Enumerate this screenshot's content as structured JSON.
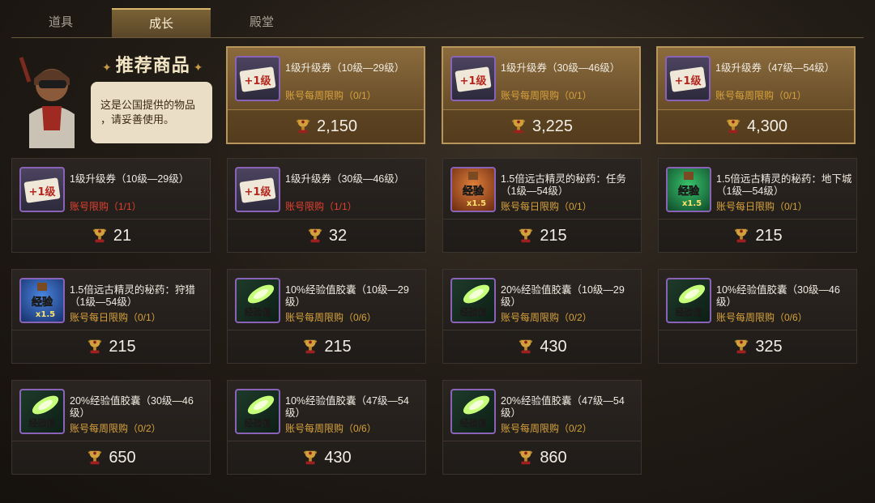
{
  "tabs": [
    {
      "label": "道具"
    },
    {
      "label": "成长"
    },
    {
      "label": "殿堂"
    }
  ],
  "promo": {
    "title": "推荐商品",
    "text_line1": "这是公国提供的物品",
    "text_line2": "，请妥善使用。"
  },
  "items": [
    {
      "name": "1级升级券（10级—29级）",
      "limit": "账号每周限购（0/1）",
      "price": "2,150",
      "icon": "level-ticket-icon"
    },
    {
      "name": "1级升级券（30级—46级）",
      "limit": "账号每周限购（0/1）",
      "price": "3,225",
      "icon": "level-ticket-icon"
    },
    {
      "name": "1级升级券（47级—54级）",
      "limit": "账号每周限购（0/1）",
      "price": "4,300",
      "icon": "level-ticket-icon"
    },
    {
      "name": "1级升级券（10级—29级）",
      "limit": "账号限购（1/1）",
      "price": "21",
      "icon": "level-ticket-icon"
    },
    {
      "name": "1级升级券（30级—46级）",
      "limit": "账号限购（1/1）",
      "price": "32",
      "icon": "level-ticket-icon"
    },
    {
      "name": "1.5倍远古精灵的秘药：任务（1级—54级）",
      "limit": "账号每日限购（0/1）",
      "price": "215",
      "icon": "exp-potion-red-icon"
    },
    {
      "name": "1.5倍远古精灵的秘药：地下城（1级—54级）",
      "limit": "账号每日限购（0/1）",
      "price": "215",
      "icon": "exp-potion-green-icon"
    },
    {
      "name": "1.5倍远古精灵的秘药：狩猎（1级—54级）",
      "limit": "账号每日限购（0/1）",
      "price": "215",
      "icon": "exp-potion-blue-icon"
    },
    {
      "name": "10%经验值胶囊（10级—29级）",
      "limit": "账号每周限购（0/6）",
      "price": "215",
      "icon": "exp-capsule-icon"
    },
    {
      "name": "20%经验值胶囊（10级—29级）",
      "limit": "账号每周限购（0/2）",
      "price": "430",
      "icon": "exp-capsule-icon"
    },
    {
      "name": "10%经验值胶囊（30级—46级）",
      "limit": "账号每周限购（0/6）",
      "price": "325",
      "icon": "exp-capsule-icon"
    },
    {
      "name": "20%经验值胶囊（30级—46级）",
      "limit": "账号每周限购（0/2）",
      "price": "650",
      "icon": "exp-capsule-icon"
    },
    {
      "name": "10%经验值胶囊（47级—54级）",
      "limit": "账号每周限购（0/6）",
      "price": "430",
      "icon": "exp-capsule-icon"
    },
    {
      "name": "20%经验值胶囊（47级—54级）",
      "limit": "账号每周限购（0/2）",
      "price": "860",
      "icon": "exp-capsule-icon"
    }
  ],
  "icon_text": {
    "ticket": "+1级",
    "potion": "经验",
    "potion_mult": "x1.5",
    "capsule": "经验值"
  },
  "colors": {
    "gold_border": "#b8955a",
    "limit_orange": "#d8a23c",
    "limit_red": "#e3412f",
    "tab_active": "#7a6236"
  }
}
